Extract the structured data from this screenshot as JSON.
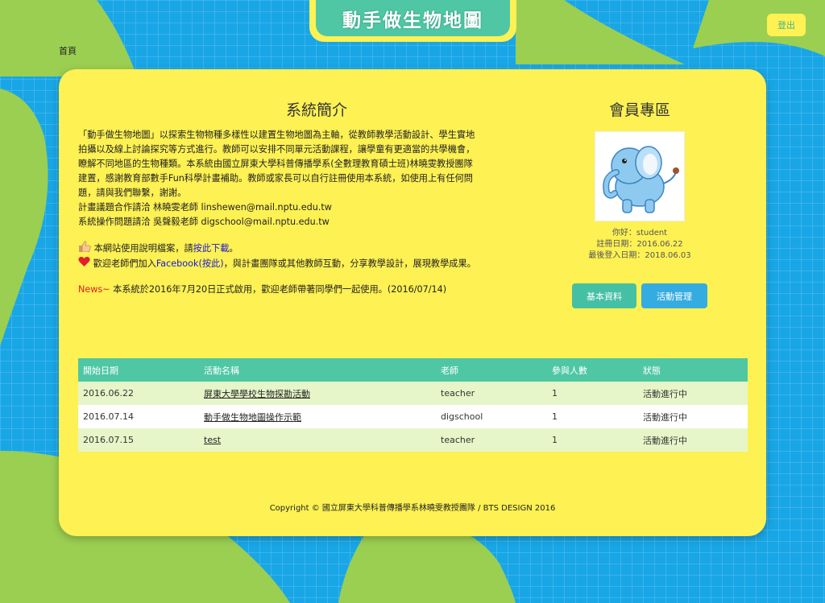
{
  "header": {
    "title": "動手做生物地圖",
    "logout_label": "登出",
    "home_label": "首頁"
  },
  "intro": {
    "title": "系統簡介",
    "lines": [
      "「動手做生物地圖」以探索生物物種多樣性以建置生物地圖為主軸，從教師教學活動設計、學生實地",
      "拍攝以及線上討論探究等方式進行。教師可以安排不同單元活動課程，讓學童有更適當的共學機會，",
      "瞭解不同地區的生物種類。本系統由國立屏東大學科普傳播學系(全數理教育碩士班)林曉雯教授團隊",
      "建置，感謝教育部數手Fun科學計畫補助。教師或家長可以自行註冊使用本系統，如使用上有任何問",
      "題，請與我們聯繫，謝謝。",
      "計畫議題合作請洽 林曉雯老師 linshewen@mail.nptu.edu.tw",
      "系統操作問題請洽 吳聲毅老師 digschool@mail.nptu.edu.tw"
    ],
    "manual_prefix": "本網站使用說明檔案，請",
    "manual_link": "按此下載",
    "manual_suffix": "。",
    "fb_prefix": "歡迎老師們加入",
    "fb_link": "Facebook(按此)",
    "fb_suffix": "，與計畫團隊或其他教師互動，分享教學設計，展現教學成果。",
    "news_label": "News~",
    "news_text": " 本系統於2016年7月20日正式啟用，歡迎老師帶著同學們一起使用。(2016/07/14)"
  },
  "member": {
    "title": "會員專區",
    "greeting": "你好：student",
    "register_date": "註冊日期：2016.06.22",
    "last_login": "最後登入日期：2018.06.03",
    "btn_profile": "基本資料",
    "btn_activity": "活動管理"
  },
  "table": {
    "headers": [
      "開始日期",
      "活動名稱",
      "老師",
      "參與人數",
      "狀態"
    ],
    "rows": [
      {
        "date": "2016.06.22",
        "name": "屏東大學學校生物探勘活動",
        "teacher": "teacher",
        "count": "1",
        "status": "活動進行中"
      },
      {
        "date": "2016.07.14",
        "name": "動手做生物地圖操作示範",
        "teacher": "digschool",
        "count": "1",
        "status": "活動進行中"
      },
      {
        "date": "2016.07.15",
        "name": "test",
        "teacher": "teacher",
        "count": "1",
        "status": "活動進行中"
      }
    ]
  },
  "footer": {
    "copyright": "Copyright © 國立屏東大學科普傳播學系林曉雯教授團隊 / BTS DESIGN 2016"
  },
  "colors": {
    "panel": "#fdf153",
    "accent_green": "#4fc7a4",
    "accent_blue": "#35ace1",
    "background": "#19a6e6"
  }
}
